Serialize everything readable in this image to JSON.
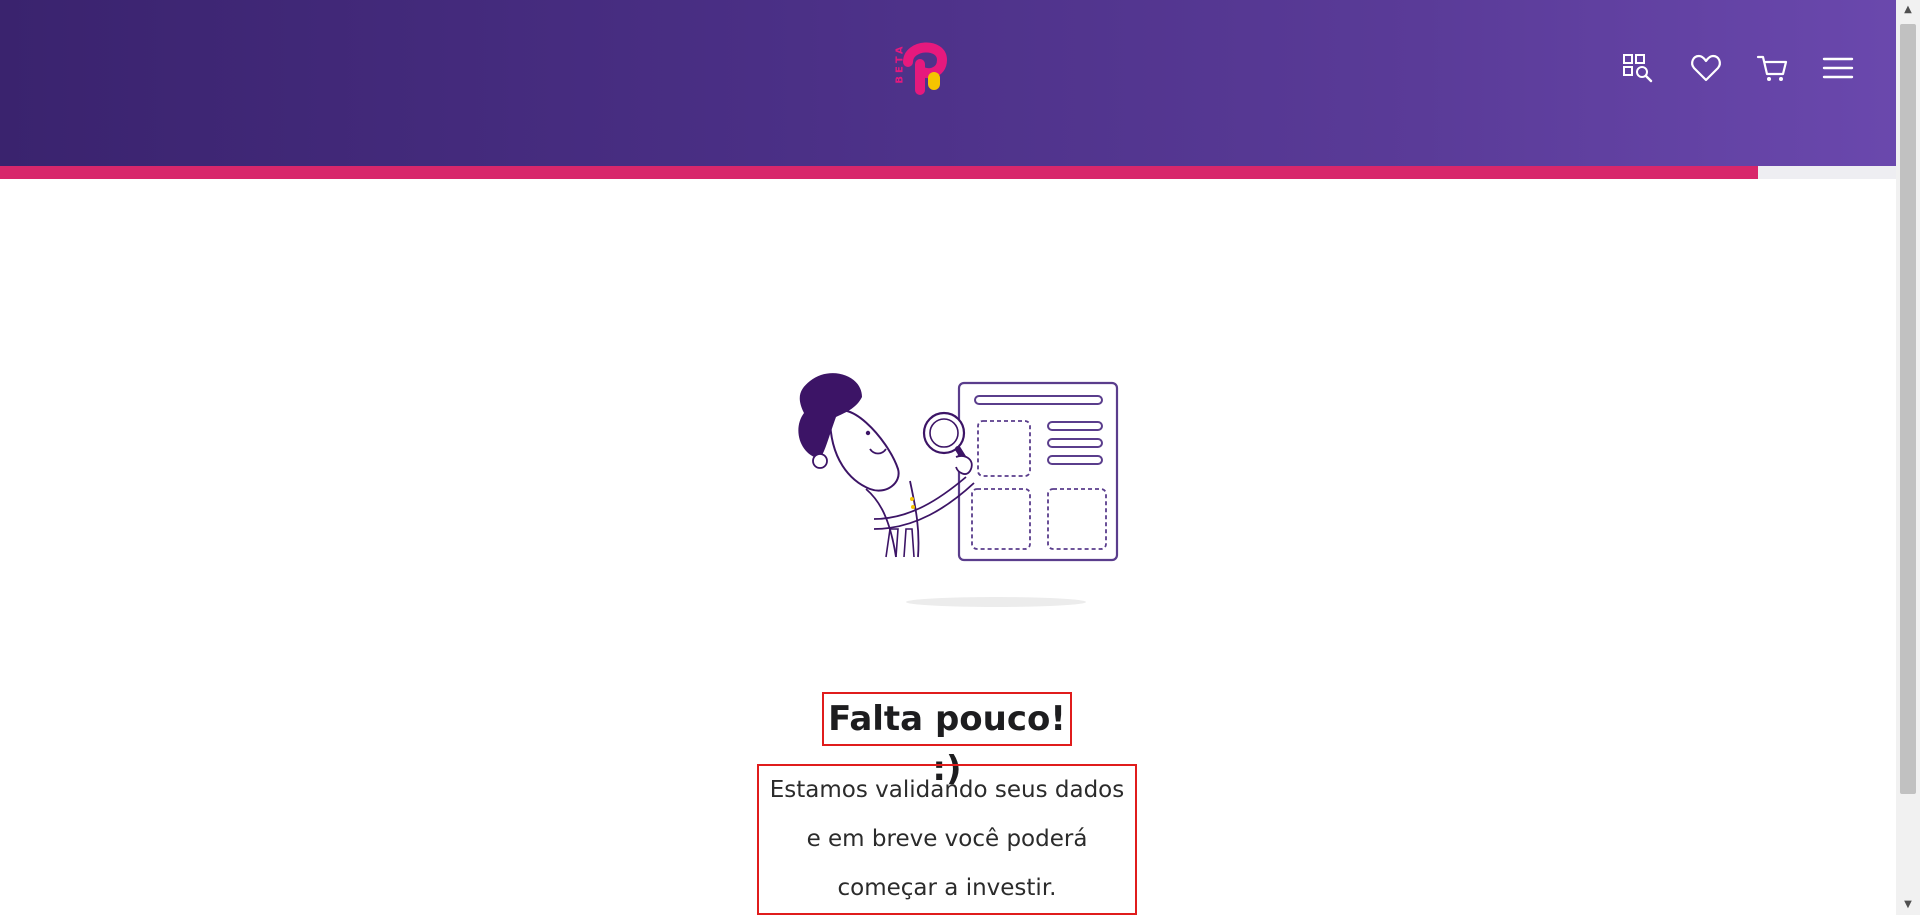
{
  "header": {
    "logo_badge": "BETA",
    "icons": [
      "search-grid-icon",
      "heart-icon",
      "cart-icon",
      "menu-icon"
    ]
  },
  "progress": {
    "fraction": 0.927,
    "fill_color": "#d8276b"
  },
  "main": {
    "title": "Falta pouco! :)",
    "message": "Estamos validando seus dados e em breve você poderá começar a investir."
  },
  "colors": {
    "header_start": "#3a236e",
    "header_end": "#6a48ad",
    "logo_pink": "#e6197d",
    "logo_yellow": "#f5c400",
    "illustration_purple": "#3c1466"
  }
}
